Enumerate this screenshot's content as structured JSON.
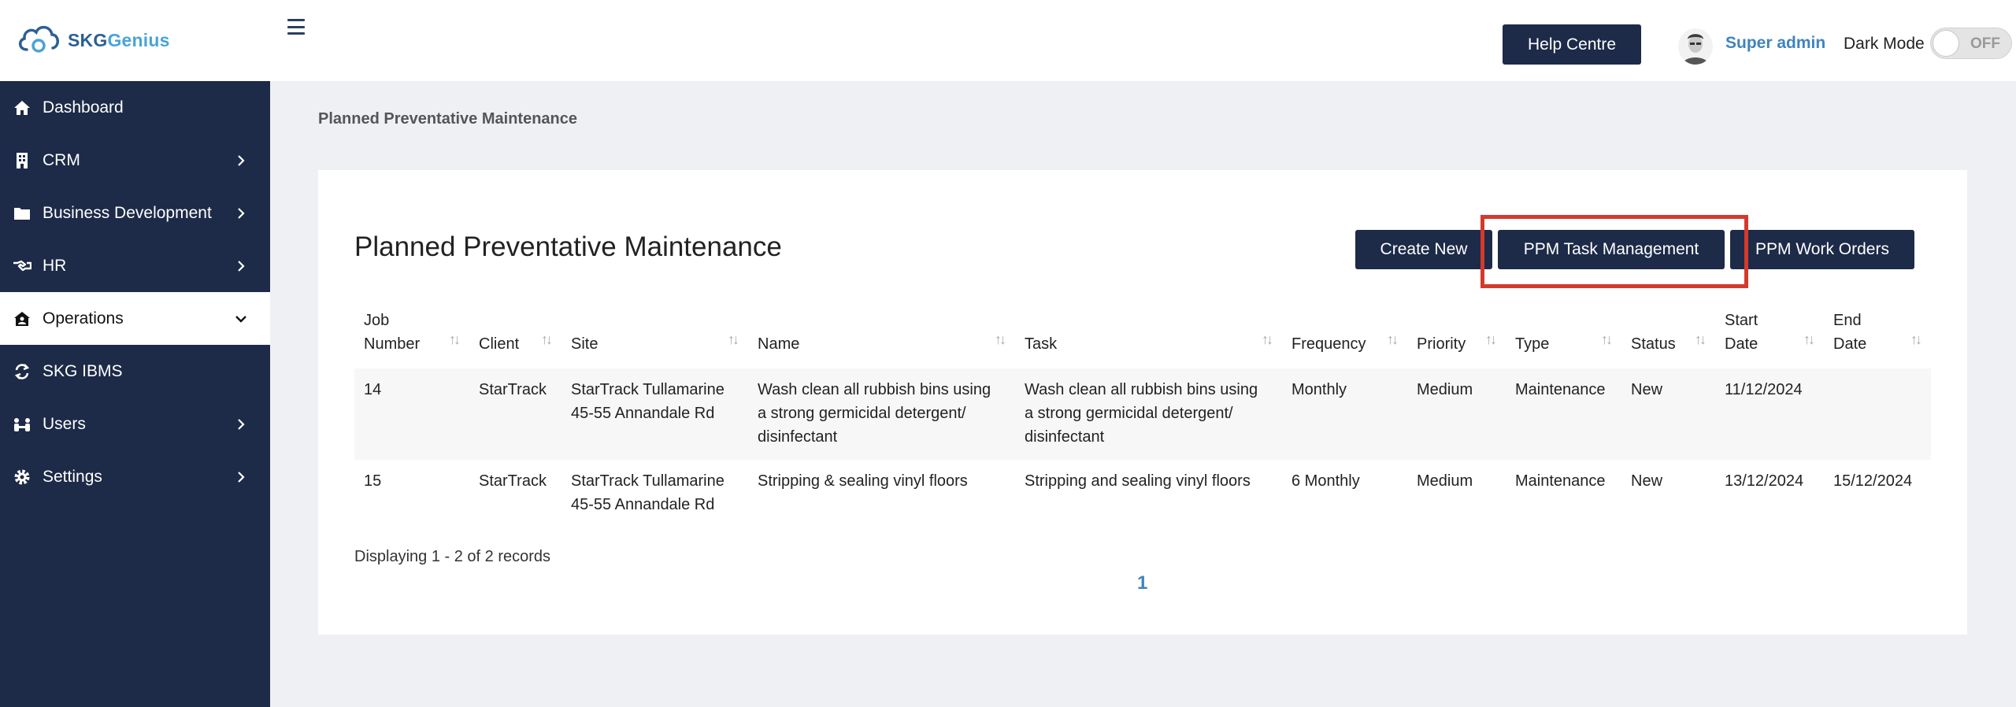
{
  "brand": {
    "name_primary": "SKG",
    "name_accent": "Genius"
  },
  "sidebar": {
    "items": [
      {
        "label": "Dashboard",
        "icon": "home-icon",
        "has_chevron": false
      },
      {
        "label": "CRM",
        "icon": "building-icon",
        "has_chevron": true
      },
      {
        "label": "Business Development",
        "icon": "folder-icon",
        "has_chevron": true
      },
      {
        "label": "HR",
        "icon": "handshake-icon",
        "has_chevron": true
      },
      {
        "label": "Operations",
        "icon": "house-user-icon",
        "has_chevron": true,
        "active": true
      },
      {
        "label": "SKG IBMS",
        "icon": "sync-icon",
        "has_chevron": false
      },
      {
        "label": "Users",
        "icon": "users-icon",
        "has_chevron": true
      },
      {
        "label": "Settings",
        "icon": "gear-icon",
        "has_chevron": true
      }
    ]
  },
  "header": {
    "help_label": "Help Centre",
    "user_name": "Super admin",
    "dark_mode_label": "Dark Mode",
    "dark_mode_state": "OFF"
  },
  "breadcrumb": "Planned Preventative Maintenance",
  "main": {
    "title": "Planned Preventative Maintenance",
    "buttons": {
      "create_new": "Create New",
      "task_management": "PPM Task Management",
      "work_orders": "PPM Work Orders"
    },
    "table": {
      "columns": [
        {
          "line1": "Job",
          "line2": "Number"
        },
        {
          "line1": "",
          "line2": "Client"
        },
        {
          "line1": "",
          "line2": "Site"
        },
        {
          "line1": "",
          "line2": "Name"
        },
        {
          "line1": "",
          "line2": "Task"
        },
        {
          "line1": "",
          "line2": "Frequency"
        },
        {
          "line1": "",
          "line2": "Priority"
        },
        {
          "line1": "",
          "line2": "Type"
        },
        {
          "line1": "",
          "line2": "Status"
        },
        {
          "line1": "Start",
          "line2": "Date"
        },
        {
          "line1": "End",
          "line2": "Date"
        }
      ],
      "rows": [
        {
          "job_number": "14",
          "client": "StarTrack",
          "site": [
            "StarTrack Tullamarine",
            "45-55 Annandale Rd"
          ],
          "name": [
            "Wash clean all rubbish bins using",
            "a strong germicidal detergent/",
            "disinfectant"
          ],
          "task": [
            "Wash clean all rubbish bins using",
            "a strong germicidal detergent/",
            "disinfectant"
          ],
          "frequency": "Monthly",
          "priority": "Medium",
          "type": "Maintenance",
          "status": "New",
          "start_date": "11/12/2024",
          "end_date": ""
        },
        {
          "job_number": "15",
          "client": "StarTrack",
          "site": [
            "StarTrack Tullamarine",
            "45-55 Annandale Rd"
          ],
          "name": [
            "Stripping & sealing vinyl floors"
          ],
          "task": [
            "Stripping and sealing vinyl floors"
          ],
          "frequency": "6 Monthly",
          "priority": "Medium",
          "type": "Maintenance",
          "status": "New",
          "start_date": "13/12/2024",
          "end_date": "15/12/2024"
        }
      ]
    },
    "records_text": "Displaying 1 - 2 of 2 records",
    "current_page": "1"
  },
  "colors": {
    "sidebar_bg": "#1d2a48",
    "button_bg": "#1d2a48",
    "accent_link": "#3f84bd",
    "highlight_border": "#d33a2c"
  }
}
